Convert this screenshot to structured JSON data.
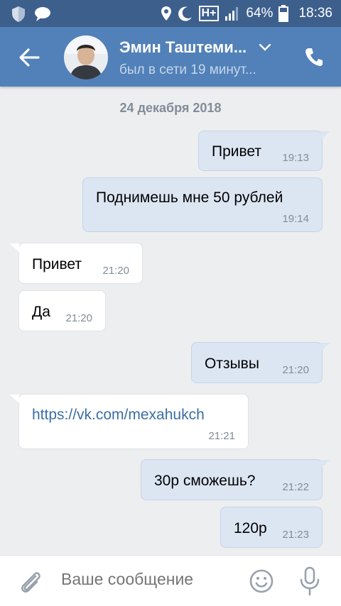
{
  "status_bar": {
    "battery": "64%",
    "time": "18:36",
    "network": "H+"
  },
  "header": {
    "name": "Эмин Таштеми...",
    "status": "был в сети 19 минут..."
  },
  "chat": {
    "date": "24 декабря 2018",
    "messages": [
      {
        "dir": "out",
        "text": "Привет",
        "time": "19:13"
      },
      {
        "dir": "out",
        "text": "Поднимешь мне 50 рублей",
        "time": "19:14"
      },
      {
        "dir": "in",
        "text": "Привет",
        "time": "21:20"
      },
      {
        "dir": "in",
        "text": "Да",
        "time": "21:20"
      },
      {
        "dir": "out",
        "text": "Отзывы",
        "time": "21:20"
      },
      {
        "dir": "in",
        "text": "https://vk.com/mexahukch",
        "time": "21:21",
        "is_link": true
      },
      {
        "dir": "out",
        "text": "30р сможешь?",
        "time": "21:22"
      },
      {
        "dir": "out",
        "text": "120р",
        "time": "21:23"
      }
    ]
  },
  "input": {
    "placeholder": "Ваше сообщение"
  },
  "colors": {
    "header": "#5181b8",
    "statusbar": "#3d5f8c",
    "out_bubble": "#dce6f3",
    "in_bubble": "#ffffff",
    "background": "#edeef0",
    "link": "#3c6ea5"
  }
}
